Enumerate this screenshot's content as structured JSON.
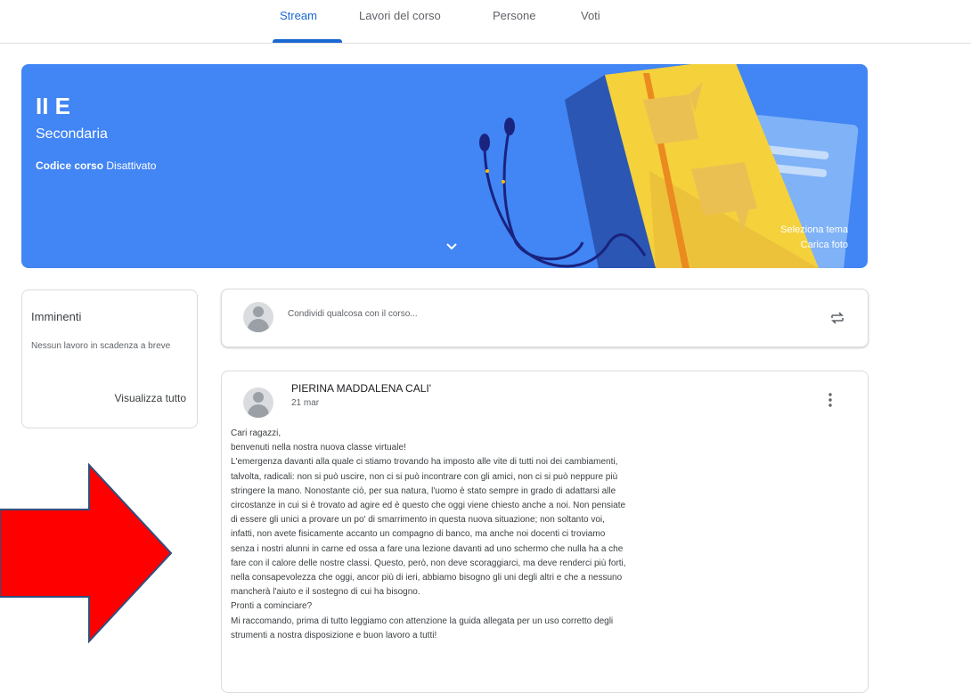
{
  "nav": {
    "tabs": [
      "Stream",
      "Lavori del corso",
      "Persone",
      "Voti"
    ],
    "active_tab": "Stream"
  },
  "banner": {
    "title": "II E",
    "subtitle": "Secondaria",
    "code_label": "Codice corso",
    "code_value": "Disattivato",
    "select_theme": "Seleziona tema",
    "upload_photo": "Carica foto",
    "color": "#4285f4"
  },
  "upcoming": {
    "title": "Imminenti",
    "empty_text": "Nessun lavoro in scadenza a breve",
    "view_all": "Visualizza tutto"
  },
  "share": {
    "placeholder": "Condividi qualcosa con il corso..."
  },
  "post": {
    "author": "PIERINA MADDALENA CALI'",
    "date": "21 mar",
    "lines": [
      "Cari ragazzi,",
      "benvenuti nella nostra nuova classe virtuale!",
      "L'emergenza davanti alla quale ci stiamo trovando ha imposto alle vite di tutti noi dei cambiamenti,",
      "talvolta, radicali: non si può uscire, non ci si può incontrare con gli amici, non ci si può neppure più",
      "stringere la mano. Nonostante ciò, per sua natura, l'uomo è stato sempre in grado di adattarsi alle",
      "circostanze in cui si è trovato ad agire ed è questo che oggi viene chiesto anche a noi. Non pensiate",
      "di essere gli unici a provare un po' di smarrimento in questa nuova situazione; non soltanto voi,",
      "infatti, non avete fisicamente accanto un compagno di banco, ma anche noi docenti ci troviamo",
      "senza i nostri alunni in carne ed ossa a fare una lezione davanti ad uno schermo che nulla ha a che",
      "fare con il calore delle nostre classi. Questo, però, non deve scoraggiarci, ma deve renderci più forti,",
      "nella consapevolezza che oggi, ancor più di ieri, abbiamo bisogno gli uni degli altri e che a nessuno",
      "mancherà l'aiuto e il sostegno di cui ha bisogno.",
      "Pronti a cominciare?",
      "Mi raccomando, prima di tutto leggiamo con attenzione la guida allegata per un uso corretto degli",
      "strumenti a nostra disposizione e buon lavoro a tutti!"
    ]
  },
  "icons": {
    "repost": "repost-icon",
    "more": "more-vert-icon",
    "chevron": "chevron-down-icon",
    "arrow": "red-arrow-annotation"
  },
  "colors": {
    "accent": "#1967d2",
    "arrow": "#ff0000"
  }
}
